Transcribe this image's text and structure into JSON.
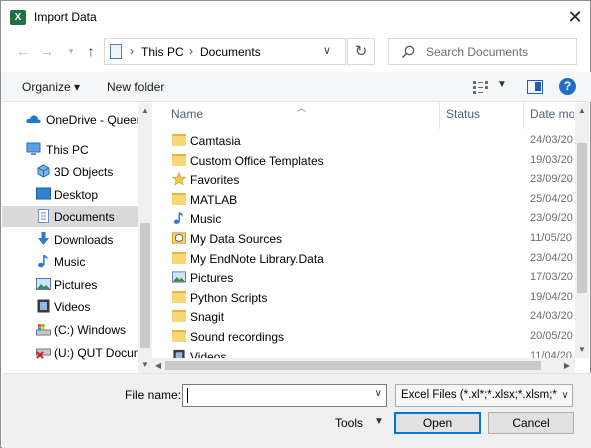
{
  "window": {
    "title": "Import Data",
    "app_icon": "X"
  },
  "address_bar": {
    "crumbs": [
      "This PC",
      "Documents"
    ]
  },
  "search": {
    "placeholder": "Search Documents"
  },
  "toolbar": {
    "organize": "Organize ▾",
    "new_folder": "New folder",
    "help": "?"
  },
  "nav_pane": {
    "items": [
      {
        "label": "OneDrive - Queen",
        "icon": "onedrive-icon"
      },
      {
        "label": "This PC",
        "icon": "computer-icon"
      },
      {
        "label": "3D Objects",
        "icon": "3d-objects-icon"
      },
      {
        "label": "Desktop",
        "icon": "desktop-icon"
      },
      {
        "label": "Documents",
        "icon": "documents-icon",
        "selected": true
      },
      {
        "label": "Downloads",
        "icon": "downloads-icon"
      },
      {
        "label": "Music",
        "icon": "music-icon"
      },
      {
        "label": "Pictures",
        "icon": "pictures-icon"
      },
      {
        "label": "Videos",
        "icon": "videos-icon"
      },
      {
        "label": "(C:) Windows",
        "icon": "drive-icon"
      },
      {
        "label": "(U:) QUT Docum",
        "icon": "network-drive-icon"
      }
    ]
  },
  "file_list": {
    "columns": [
      "Name",
      "Status",
      "Date mo"
    ],
    "rows": [
      {
        "name": "Camtasia",
        "date": "24/03/20",
        "icon": "folder-icon"
      },
      {
        "name": "Custom Office Templates",
        "date": "19/03/20",
        "icon": "folder-icon"
      },
      {
        "name": "Favorites",
        "date": "23/09/20",
        "icon": "star-icon"
      },
      {
        "name": "MATLAB",
        "date": "25/04/20",
        "icon": "folder-icon"
      },
      {
        "name": "Music",
        "date": "23/09/20",
        "icon": "music-icon"
      },
      {
        "name": "My Data Sources",
        "date": "11/05/20",
        "icon": "data-sources-icon"
      },
      {
        "name": "My EndNote Library.Data",
        "date": "23/04/20",
        "icon": "folder-icon"
      },
      {
        "name": "Pictures",
        "date": "17/03/20",
        "icon": "pictures-icon"
      },
      {
        "name": "Python Scripts",
        "date": "19/04/20",
        "icon": "folder-icon"
      },
      {
        "name": "Snagit",
        "date": "24/03/20",
        "icon": "folder-icon"
      },
      {
        "name": "Sound recordings",
        "date": "20/05/20",
        "icon": "folder-icon"
      },
      {
        "name": "Videos",
        "date": "11/04/20",
        "icon": "videos-icon"
      }
    ]
  },
  "bottom": {
    "file_name_label": "File name:",
    "file_name_value": "",
    "filter": "Excel Files (*.xl*;*.xlsx;*.xlsm;*.x",
    "tools": "Tools",
    "open": "Open",
    "cancel": "Cancel"
  }
}
